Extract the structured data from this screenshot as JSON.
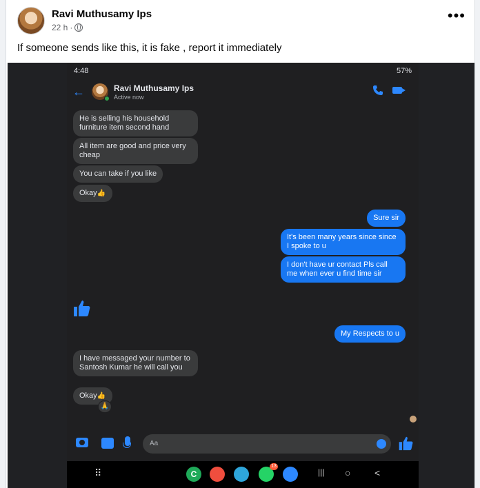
{
  "post": {
    "author": "Ravi Muthusamy Ips",
    "time": "22 h",
    "separator": "·",
    "more": "•••",
    "text": "If someone sends like this, it is fake , report it immediately"
  },
  "phone": {
    "status": {
      "time": "4:48",
      "battery": "57%"
    },
    "chat": {
      "back": "←",
      "name": "Ravi Muthusamy Ips",
      "status": "Active now"
    },
    "messages": [
      {
        "text": "He is selling his household furniture item second hand"
      },
      {
        "text": "All item are good and price very cheap"
      },
      {
        "text": "You can take if you like"
      },
      {
        "text": "Okay",
        "emoji": "👍"
      },
      {
        "text": "Sure sir"
      },
      {
        "text": "It's been many years since since I spoke to u"
      },
      {
        "text": "I don't have ur contact Pls call me when ever u find time sir"
      },
      {
        "text": "My Respects to u"
      },
      {
        "text": "I have messaged your number to Santosh Kumar he will call you"
      },
      {
        "text": "Okay",
        "emoji": "👍"
      }
    ],
    "reaction": "🙏",
    "composer": {
      "placeholder": "Aa"
    },
    "navbar": {
      "whatsapp_badge": "13",
      "recent": "|||",
      "home": "○",
      "back": "<",
      "grid": "⠿"
    }
  },
  "colors": {
    "messenger_blue": "#1877f2",
    "dark_bg": "#1f1f21",
    "incoming_bubble": "#3a3b3c"
  }
}
